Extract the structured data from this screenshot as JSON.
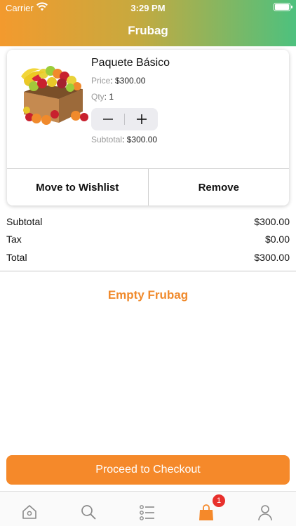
{
  "status_bar": {
    "carrier": "Carrier",
    "time": "3:29 PM"
  },
  "nav": {
    "title": "Frubag"
  },
  "cart_item": {
    "name": "Paquete Básico",
    "price_label": "Price",
    "price_value": ": $300.00",
    "qty_label": "Qty",
    "qty_value": ": 1",
    "subtotal_label": "Subtotal",
    "subtotal_value": ": $300.00",
    "move_to_wishlist_label": "Move to Wishlist",
    "remove_label": "Remove"
  },
  "summary": {
    "rows": [
      {
        "label": "Subtotal",
        "value": "$300.00"
      },
      {
        "label": "Tax",
        "value": "$0.00"
      },
      {
        "label": "Total",
        "value": "$300.00"
      }
    ]
  },
  "empty_bag_label": "Empty Frubag",
  "checkout_label": "Proceed to Checkout",
  "tabbar": {
    "tabs": [
      {
        "icon": "home-icon"
      },
      {
        "icon": "search-icon"
      },
      {
        "icon": "list-icon"
      },
      {
        "icon": "bag-icon",
        "active": true
      },
      {
        "icon": "person-icon"
      }
    ],
    "bag_badge": "1"
  },
  "colors": {
    "accent": "#f5892a",
    "header_start": "#f39a2e",
    "header_end": "#4dc17e",
    "badge": "#e8302c",
    "tab_inactive": "#8a8a8a"
  }
}
